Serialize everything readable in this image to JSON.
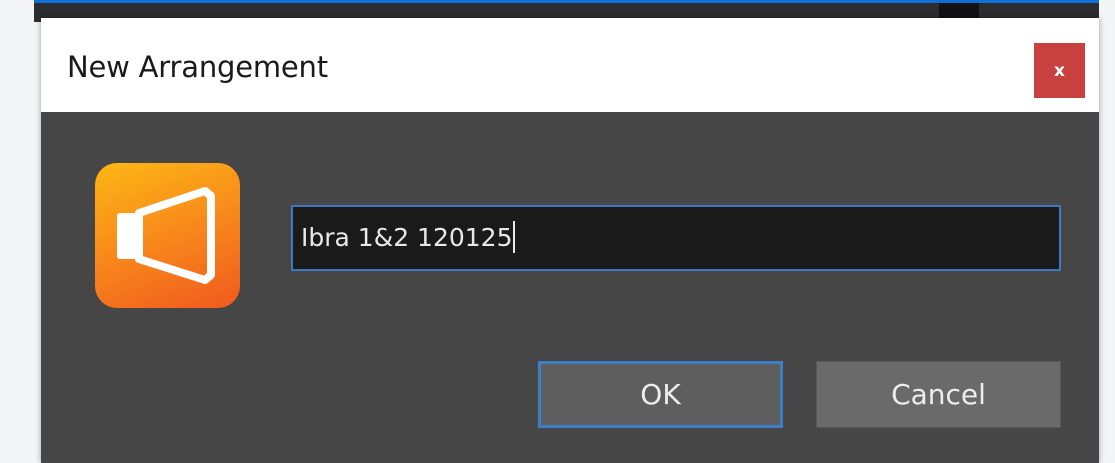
{
  "dialog": {
    "title": "New Arrangement",
    "close_label": "x",
    "app_icon": "speaker-arrangement-icon",
    "name_input": {
      "value": "Ibra 1&2 120125"
    },
    "ok_label": "OK",
    "cancel_label": "Cancel"
  },
  "colors": {
    "dialog_body": "#464646",
    "title_bar": "#ffffff",
    "close_button": "#c8413f",
    "focus_border": "#3d7ec9",
    "icon_gradient_top": "#fcb714",
    "icon_gradient_bottom": "#f05a1e"
  }
}
